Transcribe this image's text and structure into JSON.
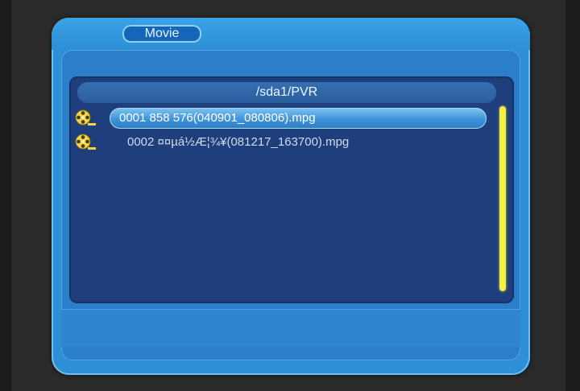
{
  "window": {
    "title": "Movie"
  },
  "browser": {
    "path": "/sda1/PVR",
    "files": [
      {
        "label": "0001  858 576(040901_080806).mpg",
        "selected": true,
        "icon": "film-reel-icon"
      },
      {
        "label": "0002  ¤¤µá½Æ¦¾¥(081217_163700).mpg",
        "selected": false,
        "icon": "film-reel-icon"
      }
    ]
  },
  "colors": {
    "frame": "#2d8fd6",
    "panel": "#1e3f7c",
    "highlight": "#3e93d8",
    "scrollbar": "#f4f04a"
  }
}
